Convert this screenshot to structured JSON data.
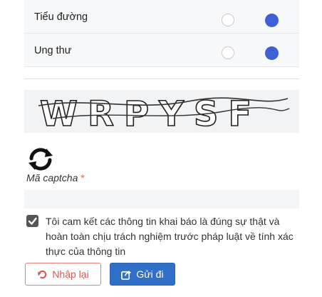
{
  "questions": [
    {
      "label": "Tiểu đường"
    },
    {
      "label": "Ung thư"
    }
  ],
  "captcha": {
    "image_text": "WRPYSF",
    "label": "Mã captcha",
    "required_mark": "*",
    "input_value": ""
  },
  "commitment": {
    "checked": true,
    "text": "Tôi cam kết các thông tin khai báo là đúng sự thật và hoàn toàn chịu trách nghiệm trước pháp luật về tính xác thực của thông tin"
  },
  "buttons": {
    "reset_label": "Nhập lại",
    "submit_label": "Gửi đi"
  },
  "colors": {
    "radio_selected": "#3f5fd6",
    "submit_bg": "#2f6fc7",
    "reset_border": "#e8807a"
  },
  "icons": {
    "refresh": "refresh-icon",
    "reset": "redo-icon",
    "submit": "share-icon"
  }
}
